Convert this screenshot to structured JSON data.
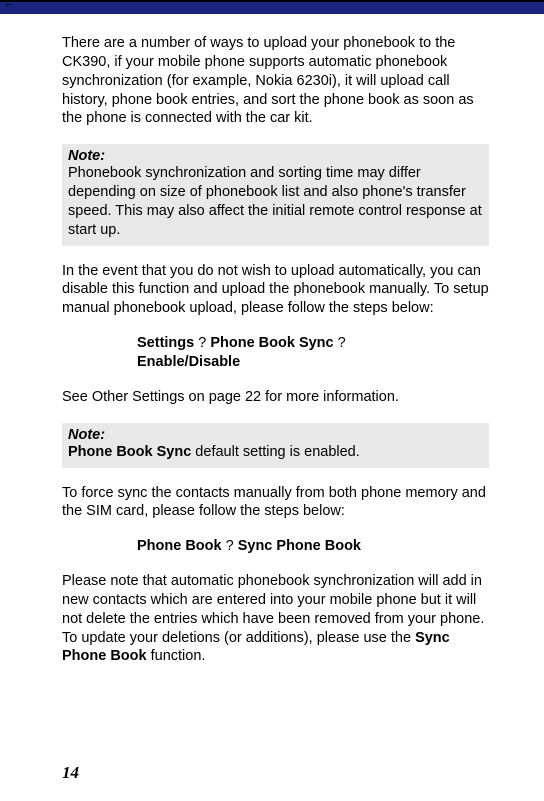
{
  "paragraphs": {
    "p1": "There are a number of ways to upload your phonebook to the CK390, if your mobile phone supports automatic phonebook synchronization (for example, Nokia 6230i), it will upload call history, phone book entries, and sort the phone book as soon as the phone is connected with the car kit.",
    "p2": "In the event that you do not wish to upload automatically, you can disable this function and upload the phonebook manually. To setup manual phonebook upload, please follow the steps below:",
    "p3": "See Other Settings on page 22 for more information.",
    "p4": "To force sync the contacts manually from both phone memory and the SIM card, please follow the steps below:",
    "p5_prefix": "Please note that automatic phonebook synchronization will add in new contacts which are entered into your mobile phone but it will not delete the entries which have been removed from your phone. To update your deletions (or additions), please use the ",
    "p5_bold": "Sync Phone Book",
    "p5_suffix": " function."
  },
  "notes": {
    "label": "Note:",
    "note1_text": "Phonebook synchronization and sorting time may differ depending on size of phonebook list and also phone's transfer speed. This may also affect the initial remote control response at start up.",
    "note2_bold": "Phone Book Sync",
    "note2_rest": " default setting is enabled."
  },
  "steps": {
    "step1_a": "Settings",
    "step1_q1": " ?  ",
    "step1_b": "Phone Book Sync",
    "step1_q2": " ? ",
    "step1_c": "Enable/Disable",
    "step2_a": "Phone Book",
    "step2_q1": " ?  ",
    "step2_b": "Sync Phone Book"
  },
  "page_number": "14"
}
